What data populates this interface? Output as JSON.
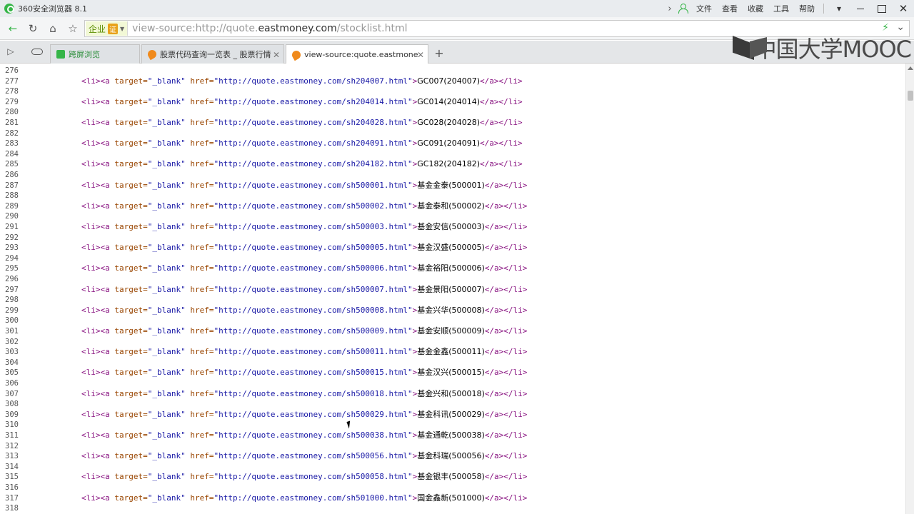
{
  "window": {
    "title": "360安全浏览器 8.1",
    "menu": [
      "文件",
      "查看",
      "收藏",
      "工具",
      "帮助"
    ]
  },
  "address_bar": {
    "badge_label": "企业",
    "badge_cert": "证",
    "url_prefix": "view-source:http://quote.",
    "url_host": "eastmoney.com",
    "url_suffix": "/stocklist.html"
  },
  "tabs": [
    {
      "label": "跨屏浏览",
      "icon": "green-square-icon"
    },
    {
      "label": "股票代码查询一览表 _ 股票行情",
      "icon": "flame-icon"
    },
    {
      "label": "view-source:quote.eastmone",
      "icon": "flame-icon",
      "active": true
    }
  ],
  "watermark": "中国大学MOOC",
  "source_lines": [
    {
      "n": "276",
      "code": null
    },
    {
      "n": "277",
      "href": "http://quote.eastmoney.com/sh204007.html",
      "text": "GC007(204007)"
    },
    {
      "n": "278",
      "code": null
    },
    {
      "n": "279",
      "href": "http://quote.eastmoney.com/sh204014.html",
      "text": "GC014(204014)"
    },
    {
      "n": "280",
      "code": null
    },
    {
      "n": "281",
      "href": "http://quote.eastmoney.com/sh204028.html",
      "text": "GC028(204028)"
    },
    {
      "n": "282",
      "code": null
    },
    {
      "n": "283",
      "href": "http://quote.eastmoney.com/sh204091.html",
      "text": "GC091(204091)"
    },
    {
      "n": "284",
      "code": null
    },
    {
      "n": "285",
      "href": "http://quote.eastmoney.com/sh204182.html",
      "text": "GC182(204182)"
    },
    {
      "n": "286",
      "code": null
    },
    {
      "n": "287",
      "href": "http://quote.eastmoney.com/sh500001.html",
      "text": "基金金泰(500001)"
    },
    {
      "n": "288",
      "code": null
    },
    {
      "n": "289",
      "href": "http://quote.eastmoney.com/sh500002.html",
      "text": "基金泰和(500002)"
    },
    {
      "n": "290",
      "code": null
    },
    {
      "n": "291",
      "href": "http://quote.eastmoney.com/sh500003.html",
      "text": "基金安信(500003)"
    },
    {
      "n": "292",
      "code": null
    },
    {
      "n": "293",
      "href": "http://quote.eastmoney.com/sh500005.html",
      "text": "基金汉盛(500005)"
    },
    {
      "n": "294",
      "code": null
    },
    {
      "n": "295",
      "href": "http://quote.eastmoney.com/sh500006.html",
      "text": "基金裕阳(500006)"
    },
    {
      "n": "296",
      "code": null
    },
    {
      "n": "297",
      "href": "http://quote.eastmoney.com/sh500007.html",
      "text": "基金景阳(500007)"
    },
    {
      "n": "298",
      "code": null
    },
    {
      "n": "299",
      "href": "http://quote.eastmoney.com/sh500008.html",
      "text": "基金兴华(500008)"
    },
    {
      "n": "300",
      "code": null
    },
    {
      "n": "301",
      "href": "http://quote.eastmoney.com/sh500009.html",
      "text": "基金安顺(500009)"
    },
    {
      "n": "302",
      "code": null
    },
    {
      "n": "303",
      "href": "http://quote.eastmoney.com/sh500011.html",
      "text": "基金金鑫(500011)"
    },
    {
      "n": "304",
      "code": null
    },
    {
      "n": "305",
      "href": "http://quote.eastmoney.com/sh500015.html",
      "text": "基金汉兴(500015)"
    },
    {
      "n": "306",
      "code": null
    },
    {
      "n": "307",
      "href": "http://quote.eastmoney.com/sh500018.html",
      "text": "基金兴和(500018)"
    },
    {
      "n": "308",
      "code": null
    },
    {
      "n": "309",
      "href": "http://quote.eastmoney.com/sh500029.html",
      "text": "基金科讯(500029)"
    },
    {
      "n": "310",
      "code": null
    },
    {
      "n": "311",
      "href": "http://quote.eastmoney.com/sh500038.html",
      "text": "基金通乾(500038)"
    },
    {
      "n": "312",
      "code": null
    },
    {
      "n": "313",
      "href": "http://quote.eastmoney.com/sh500056.html",
      "text": "基金科瑞(500056)"
    },
    {
      "n": "314",
      "code": null
    },
    {
      "n": "315",
      "href": "http://quote.eastmoney.com/sh500058.html",
      "text": "基金银丰(500058)"
    },
    {
      "n": "316",
      "code": null
    },
    {
      "n": "317",
      "href": "http://quote.eastmoney.com/sh501000.html",
      "text": "国金鑫新(501000)"
    },
    {
      "n": "318",
      "code": null
    }
  ],
  "tokens": {
    "li_open": "<li>",
    "a_open": "<a ",
    "target_attr": "target=",
    "target_val": "\"_blank\"",
    "href_attr": " href=",
    "a_close": "</a>",
    "li_close": "</li>",
    "gt": ">"
  }
}
